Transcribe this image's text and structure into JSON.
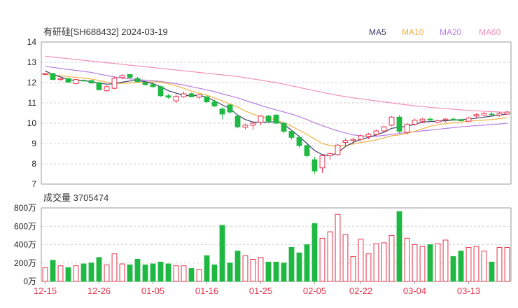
{
  "header": {
    "title": "有研硅[SH688432] 2024-03-19",
    "legend": [
      {
        "name": "MA5",
        "color": "#3b3b68"
      },
      {
        "name": "MA10",
        "color": "#f0b040"
      },
      {
        "name": "MA20",
        "color": "#b77ee0"
      },
      {
        "name": "MA60",
        "color": "#f28fb8"
      }
    ]
  },
  "volume_label": "成交量 3705474",
  "colors": {
    "up": "#e8324a",
    "down": "#1fb843",
    "grid": "#cfcfcf",
    "axis": "#222222",
    "date": "#e8324a"
  },
  "chart_data": [
    {
      "type": "candlestick",
      "title": "有研硅[SH688432] 2024-03-19",
      "ylim": [
        7,
        14
      ],
      "yticks": [
        "14",
        "13",
        "12",
        "11",
        "10",
        "9",
        "8",
        "7"
      ],
      "xticks": [
        {
          "index": 0,
          "label": "12-15"
        },
        {
          "index": 7,
          "label": "12-26"
        },
        {
          "index": 14,
          "label": "01-05"
        },
        {
          "index": 21,
          "label": "01-16"
        },
        {
          "index": 28,
          "label": "01-25"
        },
        {
          "index": 35,
          "label": "02-05"
        },
        {
          "index": 41,
          "label": "02-22"
        },
        {
          "index": 48,
          "label": "03-04"
        },
        {
          "index": 55,
          "label": "03-13"
        }
      ],
      "ohlc": [
        [
          12.4,
          12.48,
          12.35,
          12.45
        ],
        [
          12.45,
          12.48,
          12.12,
          12.15
        ],
        [
          12.15,
          12.22,
          12.1,
          12.2
        ],
        [
          12.2,
          12.22,
          12.0,
          12.02
        ],
        [
          11.95,
          12.18,
          11.92,
          12.15
        ],
        [
          12.12,
          12.15,
          12.05,
          12.08
        ],
        [
          12.1,
          12.12,
          11.95,
          11.98
        ],
        [
          12.0,
          12.05,
          11.6,
          11.65
        ],
        [
          11.6,
          11.85,
          11.55,
          11.8
        ],
        [
          11.72,
          12.3,
          11.68,
          12.22
        ],
        [
          12.25,
          12.42,
          12.18,
          12.35
        ],
        [
          12.4,
          12.42,
          12.2,
          12.25
        ],
        [
          12.2,
          12.28,
          12.0,
          12.05
        ],
        [
          12.0,
          12.08,
          11.85,
          11.9
        ],
        [
          11.9,
          12.02,
          11.75,
          11.8
        ],
        [
          11.8,
          11.85,
          11.3,
          11.35
        ],
        [
          11.35,
          11.45,
          11.2,
          11.28
        ],
        [
          11.1,
          11.4,
          11.0,
          11.32
        ],
        [
          11.3,
          11.55,
          11.25,
          11.45
        ],
        [
          11.45,
          11.5,
          11.28,
          11.3
        ],
        [
          11.28,
          11.45,
          11.2,
          11.4
        ],
        [
          11.3,
          11.35,
          11.0,
          11.05
        ],
        [
          11.05,
          11.15,
          10.8,
          10.85
        ],
        [
          10.7,
          10.78,
          10.2,
          10.45
        ],
        [
          10.9,
          10.95,
          10.45,
          10.55
        ],
        [
          10.35,
          10.42,
          9.75,
          9.82
        ],
        [
          9.8,
          9.98,
          9.7,
          9.9
        ],
        [
          9.9,
          10.05,
          9.68,
          10.0
        ],
        [
          10.05,
          10.4,
          9.92,
          10.35
        ],
        [
          10.35,
          10.4,
          10.05,
          10.1
        ],
        [
          10.4,
          10.45,
          9.95,
          10.0
        ],
        [
          10.0,
          10.05,
          9.5,
          9.6
        ],
        [
          9.6,
          9.65,
          9.2,
          9.3
        ],
        [
          9.3,
          9.35,
          8.8,
          8.9
        ],
        [
          8.9,
          8.95,
          8.3,
          8.4
        ],
        [
          8.2,
          8.35,
          7.5,
          7.65
        ],
        [
          7.8,
          8.45,
          7.55,
          8.4
        ],
        [
          8.4,
          8.55,
          8.2,
          8.5
        ],
        [
          8.45,
          8.98,
          8.4,
          8.92
        ],
        [
          9.05,
          9.25,
          8.9,
          9.15
        ],
        [
          9.15,
          9.28,
          8.95,
          9.2
        ],
        [
          9.2,
          9.45,
          9.12,
          9.38
        ],
        [
          9.35,
          9.52,
          9.22,
          9.45
        ],
        [
          9.45,
          9.68,
          9.38,
          9.62
        ],
        [
          9.62,
          9.88,
          9.55,
          9.82
        ],
        [
          9.9,
          10.35,
          9.85,
          10.3
        ],
        [
          10.3,
          10.4,
          9.5,
          9.6
        ],
        [
          9.55,
          10.0,
          9.45,
          9.95
        ],
        [
          9.95,
          10.22,
          9.88,
          10.15
        ],
        [
          10.1,
          10.25,
          10.0,
          10.2
        ],
        [
          10.2,
          10.3,
          10.12,
          10.15
        ],
        [
          10.05,
          10.18,
          10.0,
          10.12
        ],
        [
          10.15,
          10.25,
          10.05,
          10.2
        ],
        [
          10.2,
          10.28,
          10.12,
          10.15
        ],
        [
          10.18,
          10.22,
          10.08,
          10.12
        ],
        [
          10.1,
          10.3,
          10.05,
          10.25
        ],
        [
          10.35,
          10.5,
          10.28,
          10.42
        ],
        [
          10.4,
          10.55,
          10.35,
          10.48
        ],
        [
          10.45,
          10.55,
          10.38,
          10.42
        ],
        [
          10.4,
          10.55,
          10.32,
          10.48
        ],
        [
          10.45,
          10.62,
          10.4,
          10.55
        ]
      ],
      "ma": {
        "MA5": [
          12.58,
          12.4,
          12.28,
          12.15,
          12.1,
          12.1,
          12.05,
          11.98,
          11.92,
          11.95,
          12.02,
          12.08,
          12.1,
          12.05,
          11.95,
          11.8,
          11.6,
          11.48,
          11.38,
          11.35,
          11.38,
          11.28,
          11.1,
          10.9,
          10.72,
          10.4,
          10.18,
          10.05,
          10.05,
          10.05,
          10.08,
          9.95,
          9.65,
          9.35,
          9.0,
          8.65,
          8.45,
          8.4,
          8.55,
          8.85,
          9.05,
          9.2,
          9.3,
          9.42,
          9.55,
          9.75,
          9.8,
          9.85,
          9.95,
          10.05,
          10.08,
          10.1,
          10.12,
          10.15,
          10.17,
          10.2,
          10.25,
          10.3,
          10.35,
          10.4,
          10.45
        ],
        "MA10": [
          12.42,
          12.38,
          12.34,
          12.3,
          12.26,
          12.22,
          12.18,
          12.1,
          12.02,
          11.96,
          11.96,
          11.98,
          12.0,
          12.02,
          12.04,
          12.02,
          11.95,
          11.85,
          11.72,
          11.58,
          11.48,
          11.38,
          11.25,
          11.1,
          10.95,
          10.8,
          10.6,
          10.45,
          10.32,
          10.25,
          10.15,
          10.02,
          9.85,
          9.65,
          9.45,
          9.22,
          9.0,
          8.9,
          8.85,
          8.9,
          8.98,
          9.05,
          9.1,
          9.18,
          9.28,
          9.38,
          9.42,
          9.5,
          9.6,
          9.72,
          9.85,
          9.92,
          9.98,
          10.02,
          10.06,
          10.1,
          10.13,
          10.15,
          10.18,
          10.22,
          10.28
        ],
        "MA20": [
          12.8,
          12.75,
          12.7,
          12.65,
          12.6,
          12.55,
          12.5,
          12.42,
          12.35,
          12.28,
          12.22,
          12.18,
          12.15,
          12.12,
          12.1,
          12.05,
          12.0,
          11.95,
          11.88,
          11.8,
          11.72,
          11.64,
          11.55,
          11.45,
          11.35,
          11.25,
          11.12,
          11.0,
          10.88,
          10.76,
          10.65,
          10.55,
          10.45,
          10.32,
          10.18,
          10.02,
          9.88,
          9.75,
          9.62,
          9.52,
          9.42,
          9.38,
          9.35,
          9.36,
          9.4,
          9.45,
          9.5,
          9.54,
          9.58,
          9.62,
          9.66,
          9.7,
          9.74,
          9.78,
          9.82,
          9.85,
          9.88,
          9.9,
          9.93,
          9.96,
          10.0
        ],
        "MA60": [
          13.3,
          13.26,
          13.22,
          13.18,
          13.14,
          13.1,
          13.06,
          13.02,
          12.98,
          12.94,
          12.9,
          12.86,
          12.82,
          12.78,
          12.74,
          12.7,
          12.66,
          12.62,
          12.58,
          12.54,
          12.5,
          12.46,
          12.42,
          12.38,
          12.34,
          12.3,
          12.24,
          12.18,
          12.12,
          12.06,
          12.0,
          11.92,
          11.84,
          11.76,
          11.68,
          11.6,
          11.52,
          11.44,
          11.37,
          11.31,
          11.25,
          11.2,
          11.15,
          11.1,
          11.05,
          11.0,
          10.95,
          10.9,
          10.86,
          10.82,
          10.78,
          10.75,
          10.72,
          10.69,
          10.66,
          10.63,
          10.61,
          10.59,
          10.57,
          10.55,
          10.53
        ]
      }
    },
    {
      "type": "bar",
      "title": "成交量 3705474",
      "ylim": [
        0,
        800
      ],
      "yticks": [
        "800万",
        "600万",
        "400万",
        "200万",
        "0万"
      ],
      "values": [
        150,
        230,
        170,
        150,
        170,
        190,
        200,
        260,
        180,
        300,
        190,
        180,
        240,
        180,
        190,
        210,
        190,
        170,
        170,
        140,
        130,
        280,
        180,
        610,
        200,
        330,
        280,
        240,
        260,
        210,
        210,
        200,
        370,
        310,
        400,
        630,
        470,
        540,
        730,
        510,
        270,
        460,
        300,
        410,
        420,
        500,
        760,
        470,
        400,
        380,
        400,
        410,
        450,
        270,
        330,
        370,
        380,
        330,
        210,
        370,
        370
      ]
    }
  ]
}
